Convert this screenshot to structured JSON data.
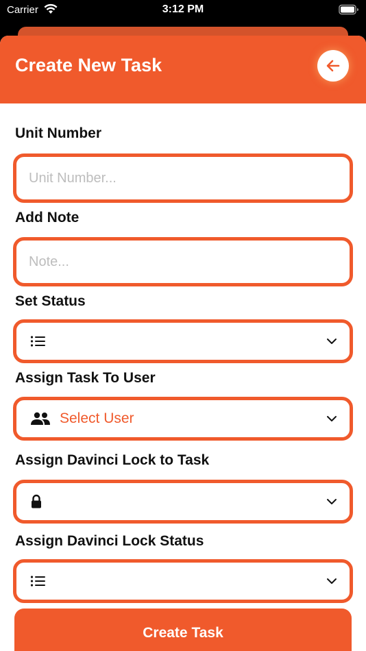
{
  "status_bar": {
    "carrier": "Carrier",
    "time": "3:12 PM"
  },
  "header": {
    "title": "Create New Task",
    "back_icon": "arrow-left-icon"
  },
  "form": {
    "unit_number": {
      "label": "Unit Number",
      "placeholder": "Unit Number..."
    },
    "note": {
      "label": "Add Note",
      "placeholder": "Note..."
    },
    "status": {
      "label": "Set Status",
      "value": ""
    },
    "assign_user": {
      "label": "Assign Task To User",
      "value": "Select User"
    },
    "lock": {
      "label": "Assign Davinci Lock to Task",
      "value": ""
    },
    "lock_status": {
      "label": "Assign Davinci Lock Status",
      "value": ""
    }
  },
  "create_button": {
    "label": "Create Task"
  },
  "colors": {
    "accent": "#f05a2c",
    "accent_dark": "#d4532b",
    "placeholder": "#bdbdbd"
  }
}
